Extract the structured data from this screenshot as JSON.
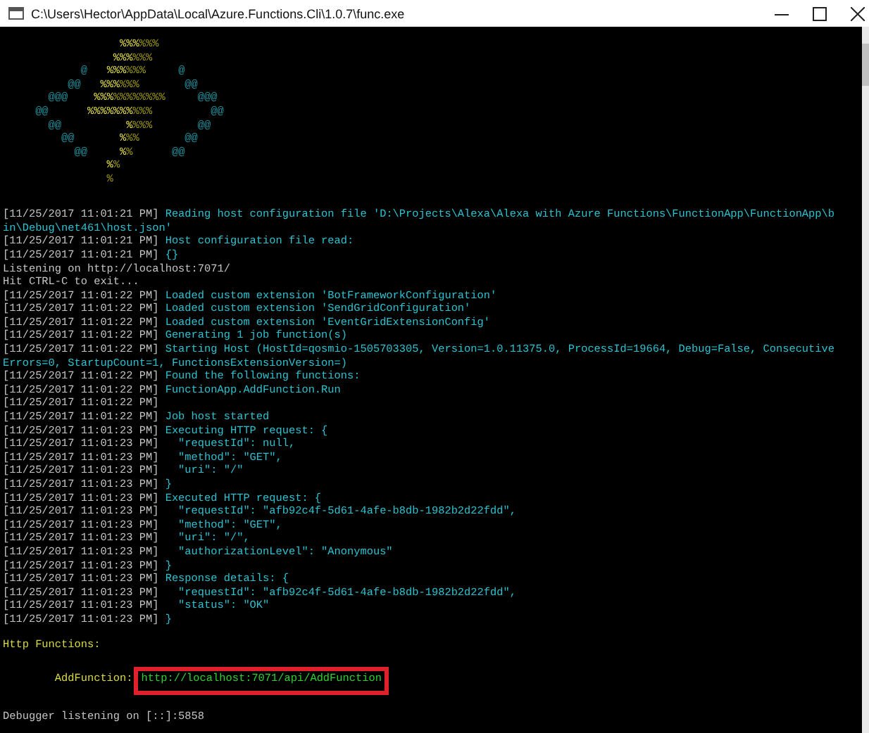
{
  "window": {
    "title": "C:\\Users\\Hector\\AppData\\Local\\Azure.Functions.Cli\\1.0.7\\func.exe"
  },
  "logo": [
    [
      {
        "kind": "bright",
        "text": "                  %%%"
      },
      {
        "kind": "dim",
        "text": "%%%"
      }
    ],
    [
      {
        "kind": "bright",
        "text": "                 %%%"
      },
      {
        "kind": "dim",
        "text": "%%%"
      }
    ],
    [
      {
        "kind": "at",
        "text": "            @"
      },
      {
        "kind": "bright",
        "text": "   %%%"
      },
      {
        "kind": "dim",
        "text": "%%%"
      },
      {
        "kind": "at",
        "text": "     @"
      }
    ],
    [
      {
        "kind": "at",
        "text": "          @@"
      },
      {
        "kind": "bright",
        "text": "   %%%"
      },
      {
        "kind": "dim",
        "text": "%%%"
      },
      {
        "kind": "at",
        "text": "       @@"
      }
    ],
    [
      {
        "kind": "at",
        "text": "       @@@"
      },
      {
        "kind": "bright",
        "text": "    %%%"
      },
      {
        "kind": "dim",
        "text": "%%%%%%%%"
      },
      {
        "kind": "at",
        "text": "     @@@"
      }
    ],
    [
      {
        "kind": "at",
        "text": "     @@"
      },
      {
        "kind": "bright",
        "text": "      %%%%%%%"
      },
      {
        "kind": "dim",
        "text": "%%%"
      },
      {
        "kind": "at",
        "text": "         @@"
      }
    ],
    [
      {
        "kind": "at",
        "text": "       @@"
      },
      {
        "kind": "bright",
        "text": "          %"
      },
      {
        "kind": "dim",
        "text": "%%%"
      },
      {
        "kind": "at",
        "text": "       @@"
      }
    ],
    [
      {
        "kind": "at",
        "text": "         @@"
      },
      {
        "kind": "bright",
        "text": "       %"
      },
      {
        "kind": "dim",
        "text": "%%"
      },
      {
        "kind": "at",
        "text": "       @@"
      }
    ],
    [
      {
        "kind": "at",
        "text": "           @@"
      },
      {
        "kind": "bright",
        "text": "     %"
      },
      {
        "kind": "dim",
        "text": "%"
      },
      {
        "kind": "at",
        "text": "      @@"
      }
    ],
    [
      {
        "kind": "bright",
        "text": "                %"
      },
      {
        "kind": "dim",
        "text": "%"
      }
    ],
    [
      {
        "kind": "dim",
        "text": "                %"
      }
    ]
  ],
  "lines": [
    {
      "kind": "log",
      "time": "[11/25/2017 11:01:21 PM]",
      "text": " Reading host configuration file 'D:\\Projects\\Alexa\\Alexa with Azure Functions\\FunctionApp\\FunctionApp\\b"
    },
    {
      "kind": "wrap",
      "text": "in\\Debug\\net461\\host.json'"
    },
    {
      "kind": "log",
      "time": "[11/25/2017 11:01:21 PM]",
      "text": " Host configuration file read:"
    },
    {
      "kind": "log",
      "time": "[11/25/2017 11:01:21 PM]",
      "text": " {}"
    },
    {
      "kind": "plain",
      "text": "Listening on http://localhost:7071/"
    },
    {
      "kind": "plain",
      "text": "Hit CTRL-C to exit..."
    },
    {
      "kind": "log",
      "time": "[11/25/2017 11:01:22 PM]",
      "text": " Loaded custom extension 'BotFrameworkConfiguration'"
    },
    {
      "kind": "log",
      "time": "[11/25/2017 11:01:22 PM]",
      "text": " Loaded custom extension 'SendGridConfiguration'"
    },
    {
      "kind": "log",
      "time": "[11/25/2017 11:01:22 PM]",
      "text": " Loaded custom extension 'EventGridExtensionConfig'"
    },
    {
      "kind": "log",
      "time": "[11/25/2017 11:01:22 PM]",
      "text": " Generating 1 job function(s)"
    },
    {
      "kind": "log",
      "time": "[11/25/2017 11:01:22 PM]",
      "text": " Starting Host (HostId=qosmio-1505703305, Version=1.0.11375.0, ProcessId=19664, Debug=False, Consecutive"
    },
    {
      "kind": "wrap",
      "text": "Errors=0, StartupCount=1, FunctionsExtensionVersion=)"
    },
    {
      "kind": "log",
      "time": "[11/25/2017 11:01:22 PM]",
      "text": " Found the following functions:"
    },
    {
      "kind": "log",
      "time": "[11/25/2017 11:01:22 PM]",
      "text": " FunctionApp.AddFunction.Run"
    },
    {
      "kind": "log",
      "time": "[11/25/2017 11:01:22 PM]"
    },
    {
      "kind": "log",
      "time": "[11/25/2017 11:01:22 PM]",
      "text": " Job host started"
    },
    {
      "kind": "log",
      "time": "[11/25/2017 11:01:23 PM]",
      "text": " Executing HTTP request: {"
    },
    {
      "kind": "log",
      "time": "[11/25/2017 11:01:23 PM]",
      "text": "   \"requestId\": null,"
    },
    {
      "kind": "log",
      "time": "[11/25/2017 11:01:23 PM]",
      "text": "   \"method\": \"GET\","
    },
    {
      "kind": "log",
      "time": "[11/25/2017 11:01:23 PM]",
      "text": "   \"uri\": \"/\""
    },
    {
      "kind": "log",
      "time": "[11/25/2017 11:01:23 PM]",
      "text": " }"
    },
    {
      "kind": "log",
      "time": "[11/25/2017 11:01:23 PM]",
      "text": " Executed HTTP request: {"
    },
    {
      "kind": "log",
      "time": "[11/25/2017 11:01:23 PM]",
      "text": "   \"requestId\": \"afb92c4f-5d61-4afe-b8db-1982b2d22fdd\","
    },
    {
      "kind": "log",
      "time": "[11/25/2017 11:01:23 PM]",
      "text": "   \"method\": \"GET\","
    },
    {
      "kind": "log",
      "time": "[11/25/2017 11:01:23 PM]",
      "text": "   \"uri\": \"/\","
    },
    {
      "kind": "log",
      "time": "[11/25/2017 11:01:23 PM]",
      "text": "   \"authorizationLevel\": \"Anonymous\""
    },
    {
      "kind": "log",
      "time": "[11/25/2017 11:01:23 PM]",
      "text": " }"
    },
    {
      "kind": "log",
      "time": "[11/25/2017 11:01:23 PM]",
      "text": " Response details: {"
    },
    {
      "kind": "log",
      "time": "[11/25/2017 11:01:23 PM]",
      "text": "   \"requestId\": \"afb92c4f-5d61-4afe-b8db-1982b2d22fdd\","
    },
    {
      "kind": "log",
      "time": "[11/25/2017 11:01:23 PM]",
      "text": "   \"status\": \"OK\""
    },
    {
      "kind": "log",
      "time": "[11/25/2017 11:01:23 PM]",
      "text": " }"
    },
    {
      "kind": "heading",
      "text": "Http Functions:"
    },
    {
      "kind": "function",
      "name": "        AddFunction:",
      "url": "http://localhost:7071/api/AddFunction",
      "highlighted": true
    },
    {
      "kind": "plain",
      "text": "Debugger listening on [::]:5858"
    }
  ]
}
